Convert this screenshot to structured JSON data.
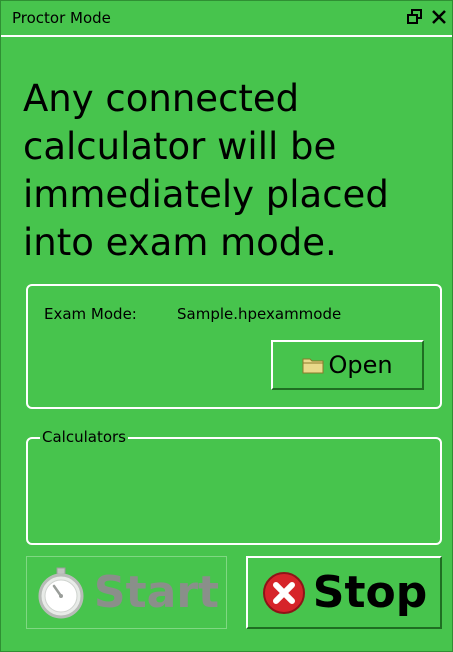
{
  "window": {
    "title": "Proctor Mode",
    "restore_icon": "restore-icon",
    "close_icon": "close-icon"
  },
  "headline": "Any connected\ncalculator will be\nimmediately placed\ninto exam mode.",
  "exam_mode": {
    "label": "Exam Mode:",
    "value": "Sample.hpexammode",
    "open_button": "Open",
    "open_icon": "folder-icon"
  },
  "calculators": {
    "legend": "Calculators",
    "items": []
  },
  "actions": {
    "start_label": "Start",
    "start_enabled": false,
    "start_icon": "stopwatch-icon",
    "stop_label": "Stop",
    "stop_icon": "stop-x-icon"
  },
  "colors": {
    "window_bg": "#47c44d",
    "border": "#ffffff",
    "disabled_text": "#8a8f8a",
    "stop_red": "#d6242a"
  }
}
